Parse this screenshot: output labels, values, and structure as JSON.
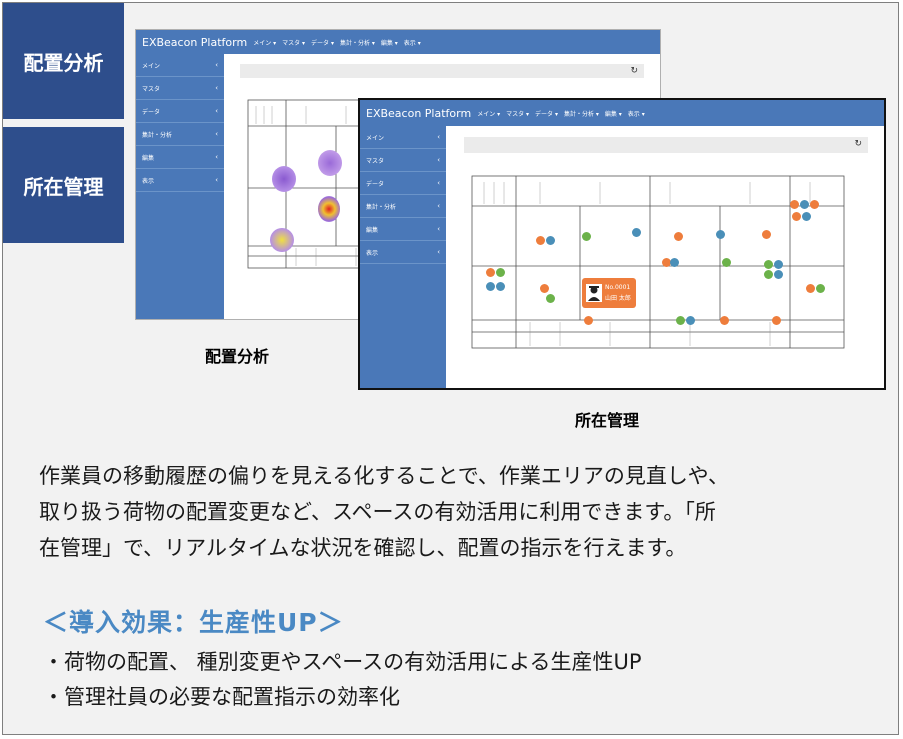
{
  "tabs": {
    "placement": "配置分析",
    "location": "所在管理"
  },
  "app": {
    "brand": "EXBeacon Platform",
    "nav": [
      "メイン ▾",
      "マスタ ▾",
      "データ ▾",
      "集計・分析 ▾",
      "編集 ▾",
      "表示 ▾"
    ],
    "sidebar": [
      "メイン",
      "マスタ",
      "データ",
      "集計・分析",
      "編集",
      "表示"
    ],
    "refresh_icon": "↻",
    "person_card": {
      "id": "No.0001",
      "name": "山田 太郎"
    }
  },
  "captions": {
    "placement": "配置分析",
    "location": "所在管理"
  },
  "description": {
    "line1": "作業員の移動履歴の偏りを見える化することで、作業エリアの見直しや、",
    "line2": "取り扱う荷物の配置変更など、スペースの有効活用に利用できます。「所",
    "line3": "在管理」で、リアルタイムな状況を確認し、配置の指示を行えます。"
  },
  "effect": {
    "title": "＜導入効果：生産性UP＞",
    "bullets": [
      "・荷物の配置、 種別変更やスペースの有効活用による生産性UP",
      "・管理社員の必要な配置指示の効率化"
    ]
  },
  "colors": {
    "tab_bg": "#2e4e8c",
    "app_bar": "#4a78b8",
    "effect_title": "#4a89c4",
    "marker_orange": "#ee7d3c",
    "marker_blue": "#4a8fb8",
    "marker_green": "#6cb24a"
  }
}
